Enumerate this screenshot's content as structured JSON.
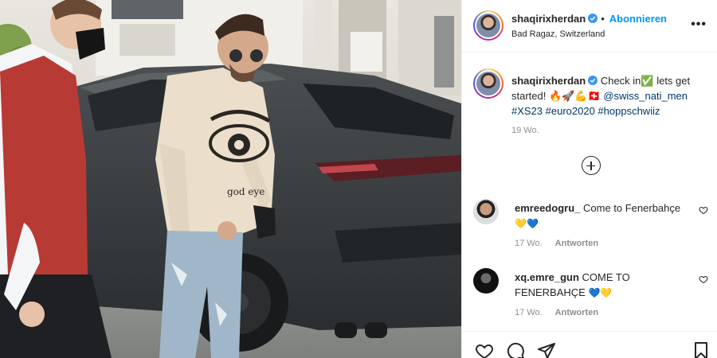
{
  "post": {
    "username": "shaqirixherdan",
    "follow_label": "Abonnieren",
    "location": "Bad Ragaz, Switzerland",
    "more_label": "•••",
    "caption": {
      "username": "shaqirixherdan",
      "text_part1": "Check in✅ lets get started! 🔥🚀💪🇨🇭 ",
      "mention": "@swiss_nati_men",
      "hashtags": "#XS23 #euro2020 #hoppschwiiz",
      "time": "19 Wo."
    },
    "comments": [
      {
        "username": "emreedogru_",
        "text": "Come to Fenerbahçe",
        "emoji": "💛💙",
        "time": "17 Wo.",
        "reply_label": "Antworten"
      },
      {
        "username": "xq.emre_gun",
        "text": "COME TO FENERBAHÇE",
        "emoji": "💙💛",
        "time": "17 Wo.",
        "reply_label": "Antworten"
      }
    ]
  },
  "photo": {
    "hoodie_print_text": "god eye"
  },
  "colors": {
    "accent_blue": "#0095f6",
    "tag_blue": "#00376b",
    "muted": "#8e8e8e",
    "border": "#efefef"
  },
  "icons": [
    "verified-icon",
    "more-options-icon",
    "load-more-comments-icon",
    "like-comment-icon",
    "like-icon",
    "comment-icon",
    "share-icon",
    "save-icon"
  ]
}
